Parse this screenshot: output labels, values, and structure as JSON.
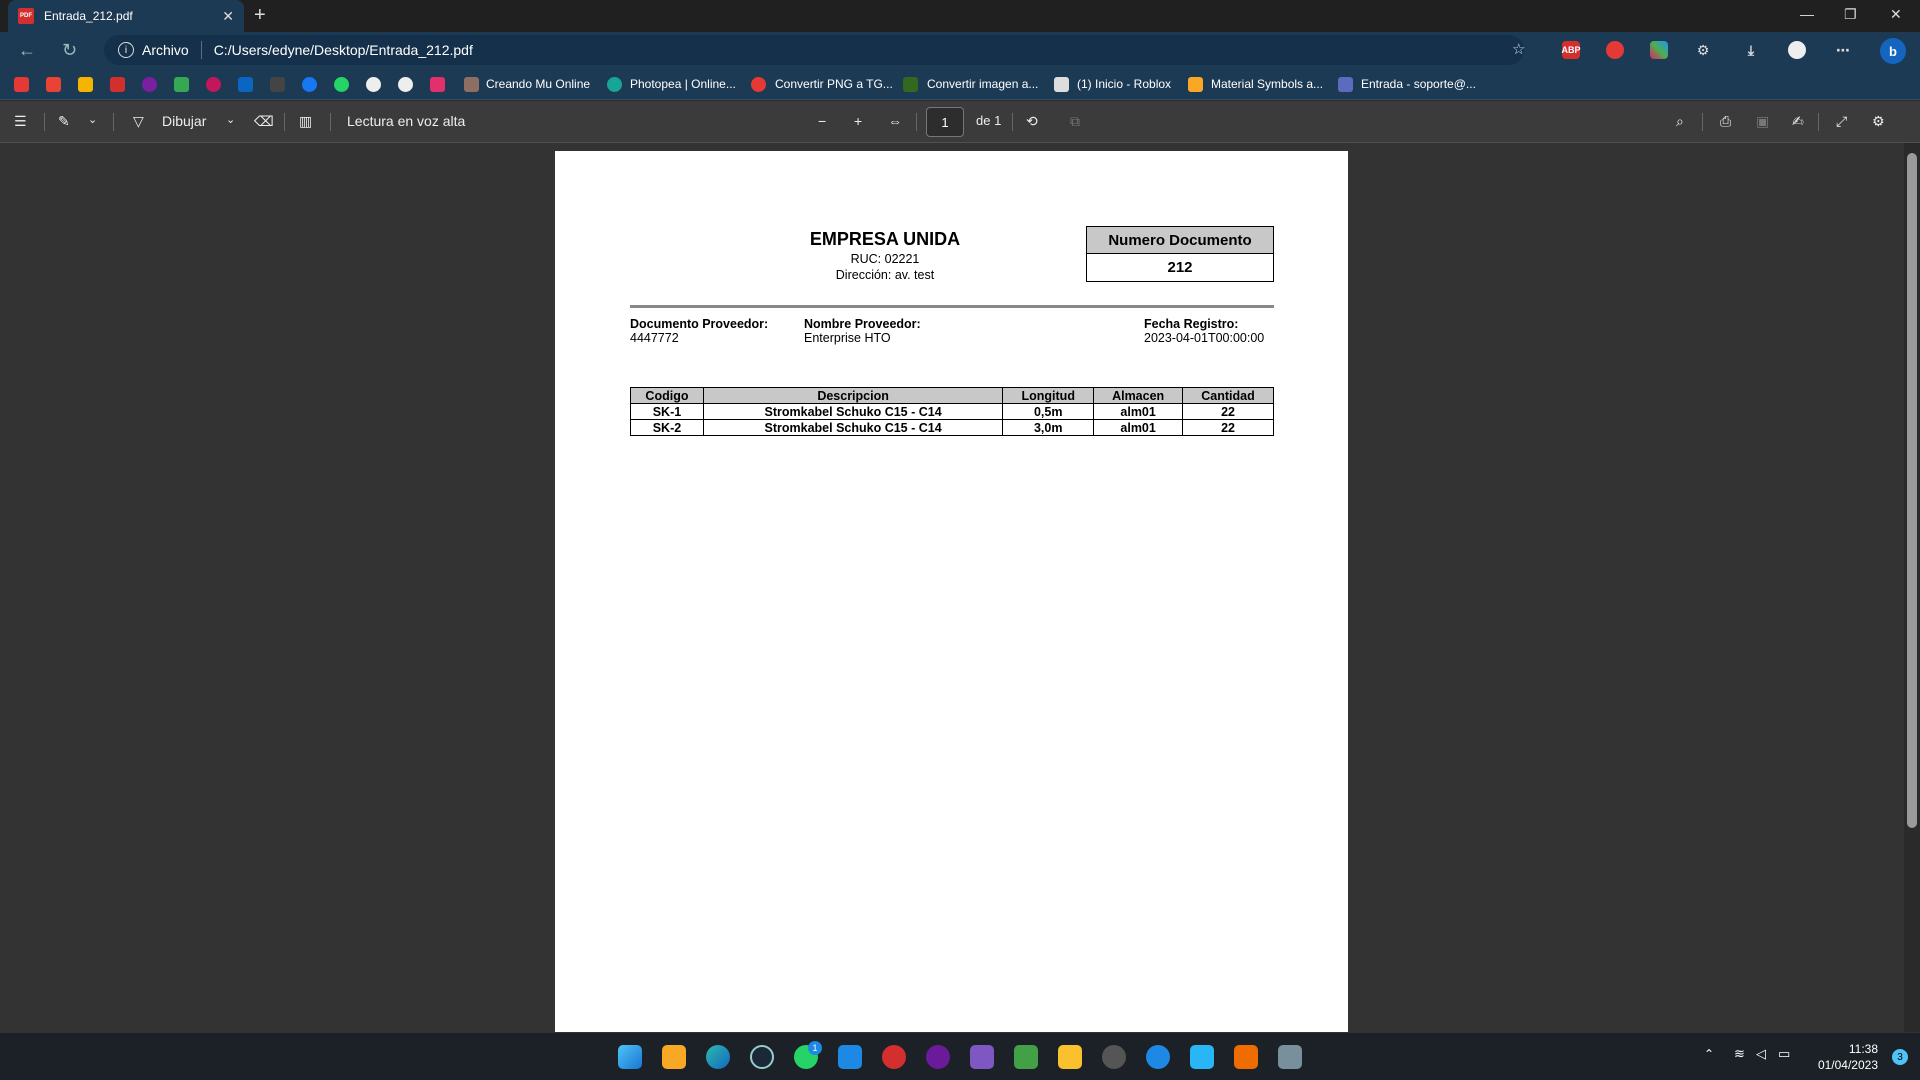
{
  "browser": {
    "tab_title": "Entrada_212.pdf",
    "tab_icon_text": "PDF",
    "address_prefix": "Archivo",
    "url": "C:/Users/edyne/Desktop/Entrada_212.pdf"
  },
  "bookmarks": [
    {
      "label": "Creando Mu Online"
    },
    {
      "label": "Photopea | Online..."
    },
    {
      "label": "Convertir PNG a TG..."
    },
    {
      "label": "Convertir imagen a..."
    },
    {
      "label": "(1) Inicio - Roblox"
    },
    {
      "label": "Material Symbols a..."
    },
    {
      "label": "Entrada - soporte@..."
    }
  ],
  "pdf_toolbar": {
    "draw_label": "Dibujar",
    "read_aloud_label": "Lectura en voz alta",
    "page_current": "1",
    "page_total_label": "de 1"
  },
  "document": {
    "company_name": "EMPRESA UNIDA",
    "ruc": "RUC: 02221",
    "address": "Dirección: av. test",
    "doc_number_header": "Numero Documento",
    "doc_number": "212",
    "provider_doc_label": "Documento Proveedor:",
    "provider_doc_value": "4447772",
    "provider_name_label": "Nombre Proveedor:",
    "provider_name_value": "Enterprise HTO",
    "date_label": "Fecha Registro:",
    "date_value": "2023-04-01T00:00:00",
    "table": {
      "headers": [
        "Codigo",
        "Descripcion",
        "Longitud",
        "Almacen",
        "Cantidad"
      ],
      "rows": [
        [
          "SK-1",
          "Stromkabel Schuko C15 - C14",
          "0,5m",
          "alm01",
          "22"
        ],
        [
          "SK-2",
          "Stromkabel Schuko C15 - C14",
          "3,0m",
          "alm01",
          "22"
        ]
      ]
    }
  },
  "taskbar": {
    "time": "11:38",
    "date": "01/04/2023",
    "notification_count": "3",
    "whatsapp_badge": "1"
  }
}
